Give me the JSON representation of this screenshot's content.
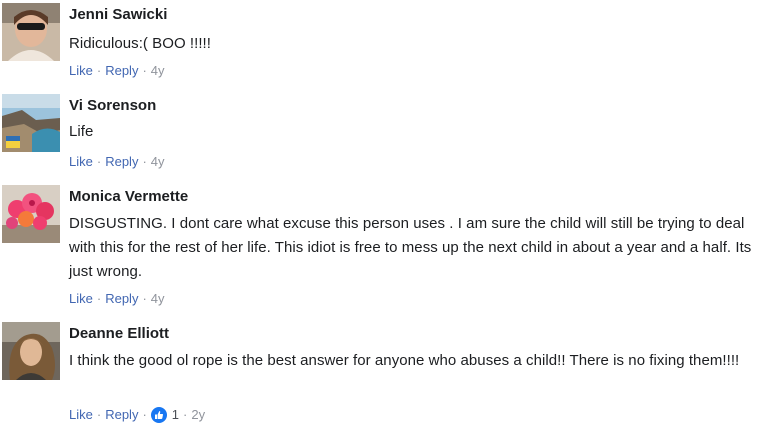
{
  "comments": [
    {
      "author": "Jenni Sawicki",
      "text": "Ridiculous:( BOO !!!!!",
      "like": "Like",
      "reply": "Reply",
      "time": "4y"
    },
    {
      "author": "Vi Sorenson",
      "text": "Life",
      "like": "Like",
      "reply": "Reply",
      "time": "4y"
    },
    {
      "author": "Monica Vermette",
      "text": "DISGUSTING. I dont care what excuse this person uses . I am sure the child will still be trying to deal with this for the rest of her life. This idiot is free to mess up the next child in about a year and a half. Its just wrong.",
      "like": "Like",
      "reply": "Reply",
      "time": "4y"
    },
    {
      "author": "Deanne Elliott",
      "text": "I think the good ol rope is the best answer for anyone who abuses a child!! There is no fixing them!!!!",
      "like": "Like",
      "reply": "Reply",
      "reaction_count": "1",
      "time": "2y"
    }
  ],
  "separator": "·",
  "colors": {
    "link": "#4267b2",
    "meta": "#90949c",
    "text": "#1c1e21",
    "like_icon": "#1877f2"
  }
}
